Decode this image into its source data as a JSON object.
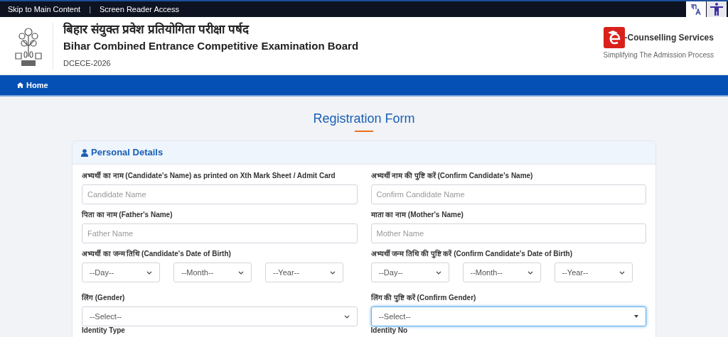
{
  "top_bar": {
    "links": [
      "Skip to Main Content",
      "Screen Reader Access"
    ],
    "separator": "|"
  },
  "header": {
    "title_hindi": "बिहार संयुक्त प्रवेश प्रतियोगिता परीक्षा पर्षद",
    "title": "Bihar Combined Entrance Competitive Examination Board",
    "subtitle": "DCECE-2026",
    "brand": "-Counselling Services",
    "tagline": "Simplifying The Admission Process"
  },
  "nav": {
    "items": [
      {
        "label": "Home",
        "selected": true
      }
    ]
  },
  "page_title": "Registration Form",
  "section": {
    "title": "Personal Details",
    "fields": [
      {
        "kind": "text",
        "label": "अभ्यर्थी का नाम (Candidate's Name) as printed on Xth Mark Sheet / Admit Card",
        "placeholder": "Candidate Name",
        "focused": false
      },
      {
        "kind": "text",
        "label": "अभ्यर्थी नाम की पुष्टि करें (Confirm Candidate's Name)",
        "placeholder": "Confirm Candidate Name",
        "focused": false
      },
      {
        "kind": "text",
        "label": "पिता का नाम (Father's Name)",
        "placeholder": "Father Name",
        "focused": false
      },
      {
        "kind": "text",
        "label": "माता का नाम (Mother's Name)",
        "placeholder": "Mother Name",
        "focused": false
      },
      {
        "kind": "date",
        "label": "अभ्यर्थी का जन्म तिथि (Candidate's Date of Birth)",
        "options": [
          "--Day--",
          "--Month--",
          "--Year--"
        ],
        "focused": false
      },
      {
        "kind": "date",
        "label": "अभ्यर्थी जन्म तिथि की पुष्टि करें (Confirm Candidate's Date of Birth)",
        "options": [
          "--Day--",
          "--Month--",
          "--Year--"
        ],
        "focused": false
      },
      {
        "kind": "select",
        "label": "लिंग (Gender)",
        "value": "--Select--",
        "focused": false
      },
      {
        "kind": "select",
        "label": "लिंग की पुष्टि करें (Confirm Gender)",
        "value": "--Select--",
        "focused": true
      },
      {
        "kind": "label",
        "label": "Identity Type"
      },
      {
        "kind": "label",
        "label": "Identity No"
      }
    ]
  }
}
